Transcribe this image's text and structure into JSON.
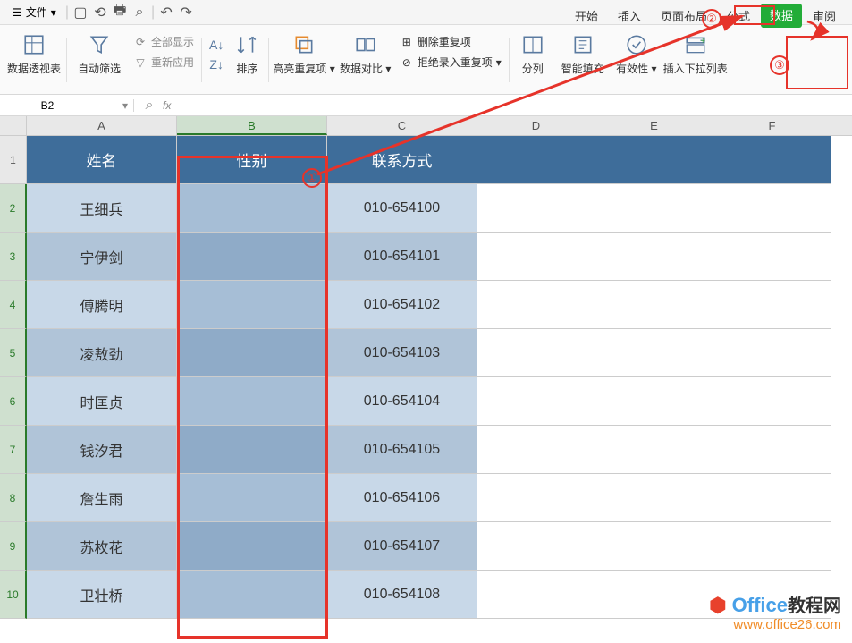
{
  "topbar": {
    "file_label": "文件",
    "tabs": {
      "start": "开始",
      "insert": "插入",
      "layout": "页面布局",
      "formula": "公式",
      "data": "数据",
      "review": "审阅"
    }
  },
  "ribbon": {
    "pivot": "数据透视表",
    "autofilter": "自动筛选",
    "showall": "全部显示",
    "reapply": "重新应用",
    "sort": "排序",
    "highlight_dup": "高亮重复项",
    "data_compare": "数据对比",
    "remove_dup": "删除重复项",
    "reject_dup": "拒绝录入重复项",
    "text_to_col": "分列",
    "smart_fill": "智能填充",
    "validation": "有效性",
    "insert_dropdown": "插入下拉列表"
  },
  "formula": {
    "cell_ref": "B2",
    "fx": "fx"
  },
  "columns": [
    "A",
    "B",
    "C",
    "D",
    "E",
    "F"
  ],
  "row_nums": [
    "1",
    "2",
    "3",
    "4",
    "5",
    "6",
    "7",
    "8",
    "9",
    "10"
  ],
  "headers": {
    "name": "姓名",
    "gender": "性别",
    "contact": "联系方式"
  },
  "rows": [
    {
      "name": "王细兵",
      "gender": "",
      "contact": "010-654100"
    },
    {
      "name": "宁伊剑",
      "gender": "",
      "contact": "010-654101"
    },
    {
      "name": "傅腾明",
      "gender": "",
      "contact": "010-654102"
    },
    {
      "name": "凌敖劲",
      "gender": "",
      "contact": "010-654103"
    },
    {
      "name": "时匡贞",
      "gender": "",
      "contact": "010-654104"
    },
    {
      "name": "钱汐君",
      "gender": "",
      "contact": "010-654105"
    },
    {
      "name": "詹生雨",
      "gender": "",
      "contact": "010-654106"
    },
    {
      "name": "苏枚花",
      "gender": "",
      "contact": "010-654107"
    },
    {
      "name": "卫壮桥",
      "gender": "",
      "contact": "010-654108"
    }
  ],
  "annotations": {
    "a1": "①",
    "a2": "②",
    "a3": "③"
  },
  "watermark": {
    "brand": "Office",
    "txt": "教程网",
    "url": "www.office26.com"
  }
}
